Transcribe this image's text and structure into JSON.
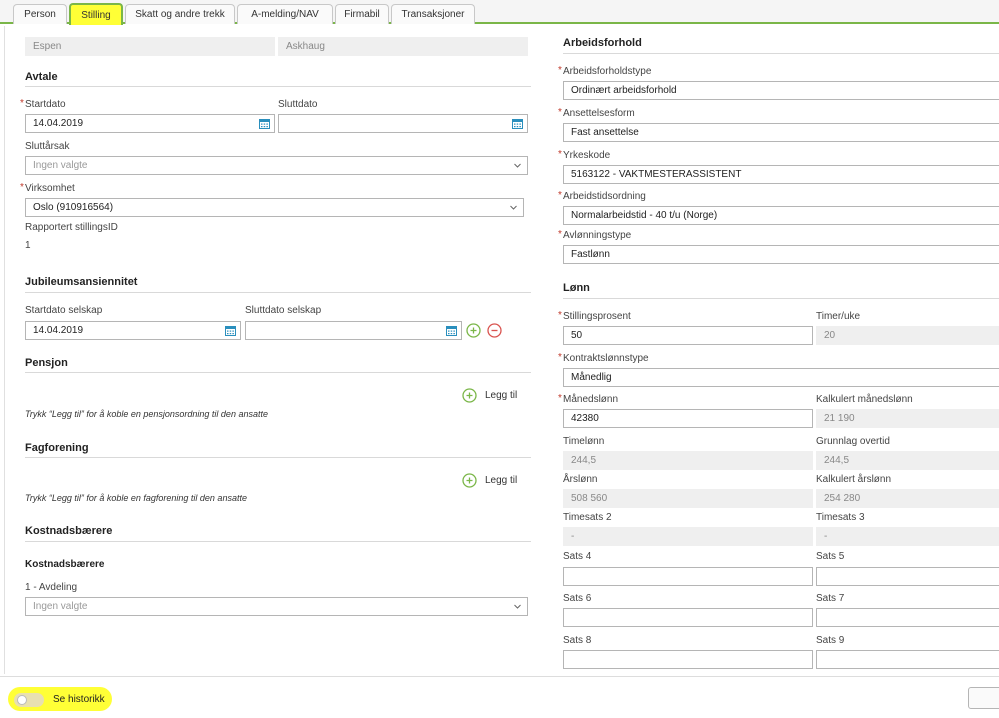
{
  "tabs": [
    "Person",
    "Stilling",
    "Skatt og andre trekk",
    "A-melding/NAV",
    "Firmabil",
    "Transaksjoner"
  ],
  "person": {
    "first_name": "Espen",
    "last_name": "Askhaug"
  },
  "avtale": {
    "title": "Avtale",
    "startdato_label": "Startdato",
    "startdato_value": "14.04.2019",
    "sluttdato_label": "Sluttdato",
    "sluttdato_value": "",
    "sluttarsak_label": "Sluttårsak",
    "sluttarsak_value": "Ingen valgte",
    "virksomhet_label": "Virksomhet",
    "virksomhet_value": "Oslo (910916564)",
    "stillingsid_label": "Rapportert stillingsID",
    "stillingsid_value": "1"
  },
  "jubileum": {
    "title": "Jubileumsansiennitet",
    "start_label": "Startdato selskap",
    "start_value": "14.04.2019",
    "slutt_label": "Sluttdato selskap",
    "slutt_value": ""
  },
  "pensjon": {
    "title": "Pensjon",
    "add_label": "Legg til",
    "hint": "Trykk “Legg til” for å koble en pensjonsordning til den ansatte"
  },
  "fagforening": {
    "title": "Fagforening",
    "add_label": "Legg til",
    "hint": "Trykk “Legg til” for å koble en fagforening til den ansatte"
  },
  "kostnad": {
    "title": "Kostnadsbærere",
    "subtitle": "Kostnadsbærere",
    "avdeling_label": "1 - Avdeling",
    "avdeling_value": "Ingen valgte"
  },
  "arbeidsforhold": {
    "title": "Arbeidsforhold",
    "type_label": "Arbeidsforholdstype",
    "type_value": "Ordinært arbeidsforhold",
    "form_label": "Ansettelsesform",
    "form_value": "Fast ansettelse",
    "yrke_label": "Yrkeskode",
    "yrke_value": "5163122 - VAKTMESTERASSISTENT",
    "tid_label": "Arbeidstidsordning",
    "tid_value": "Normalarbeidstid - 40 t/u (Norge)",
    "avl_label": "Avlønningstype",
    "avl_value": "Fastlønn"
  },
  "lonn": {
    "title": "Lønn",
    "stillingsprosent_label": "Stillingsprosent",
    "stillingsprosent_value": "50",
    "timer_label": "Timer/uke",
    "timer_value": "20",
    "kontrakt_label": "Kontraktslønnstype",
    "kontrakt_value": "Månedlig",
    "mnd_label": "Månedslønn",
    "mnd_value": "42380",
    "kalk_mnd_label": "Kalkulert månedslønn",
    "kalk_mnd_value": "21 190",
    "timelonn_label": "Timelønn",
    "timelonn_value": "244,5",
    "grunnlag_label": "Grunnlag overtid",
    "grunnlag_value": "244,5",
    "arslonn_label": "Årslønn",
    "arslonn_value": "508 560",
    "kalk_ar_label": "Kalkulert årslønn",
    "kalk_ar_value": "254 280",
    "ts2_label": "Timesats 2",
    "ts2_value": "-",
    "ts3_label": "Timesats 3",
    "ts3_value": "-",
    "s4_label": "Sats 4",
    "s5_label": "Sats 5",
    "s6_label": "Sats 6",
    "s7_label": "Sats 7",
    "s8_label": "Sats 8",
    "s9_label": "Sats 9"
  },
  "footer": {
    "history_label": "Se historikk"
  },
  "colors": {
    "accent_green": "#7ab648",
    "highlight_yellow": "#ffff36",
    "required_red": "#c0392b",
    "remove_red": "#d9534f",
    "calendar_blue": "#2a8fbd"
  }
}
